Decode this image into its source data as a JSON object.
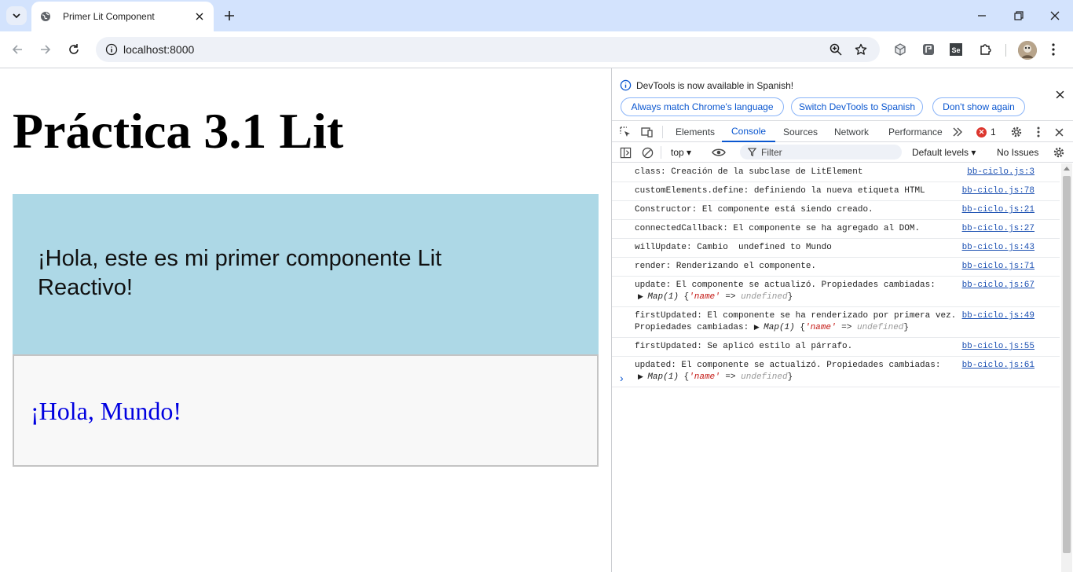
{
  "browser": {
    "tab_title": "Primer Lit Component",
    "url": "localhost:8000"
  },
  "page": {
    "heading": "Práctica 3.1 Lit",
    "component_text": "¡Hola, este es mi primer componente Lit Reactivo!",
    "greeting": "¡Hola, Mundo!"
  },
  "devtools": {
    "infobar": {
      "message": "DevTools is now available in Spanish!",
      "btn_match": "Always match Chrome's language",
      "btn_switch": "Switch DevTools to Spanish",
      "btn_dont_show": "Don't show again"
    },
    "tabs": [
      "Elements",
      "Console",
      "Sources",
      "Network",
      "Performance"
    ],
    "error_count": "1",
    "console": {
      "context": "top",
      "filter_placeholder": "Filter",
      "levels": "Default levels",
      "issues": "No Issues",
      "messages": [
        {
          "text": "class: Creación de la subclase de LitElement",
          "source": "bb-ciclo.js:3"
        },
        {
          "text": "customElements.define: definiendo la nueva etiqueta HTML",
          "source": "bb-ciclo.js:78"
        },
        {
          "text": "Constructor: El componente está siendo creado.",
          "source": "bb-ciclo.js:21"
        },
        {
          "text": "connectedCallback: El componente se ha agregado al DOM.",
          "source": "bb-ciclo.js:27"
        },
        {
          "text": "willUpdate: Cambio  undefined to Mundo",
          "source": "bb-ciclo.js:43"
        },
        {
          "text": "render: Renderizando el componente.",
          "source": "bb-ciclo.js:71"
        },
        {
          "text": "update: El componente se actualizó. Propiedades cambiadas:",
          "source": "bb-ciclo.js:67",
          "map": {
            "prefix": "",
            "label": "Map(1)",
            "key": "'name'",
            "value": "undefined"
          }
        },
        {
          "text": "firstUpdated: El componente se ha renderizado por primera vez.",
          "source": "bb-ciclo.js:49",
          "map": {
            "prefix": "Propiedades cambiadas: ",
            "label": "Map(1)",
            "key": "'name'",
            "value": "undefined"
          }
        },
        {
          "text": "firstUpdated: Se aplicó estilo al párrafo.",
          "source": "bb-ciclo.js:55"
        },
        {
          "text": "updated: El componente se actualizó. Propiedades cambiadas:",
          "source": "bb-ciclo.js:61",
          "map": {
            "prefix": "",
            "label": "Map(1)",
            "key": "'name'",
            "value": "undefined"
          }
        }
      ],
      "prompt": "›"
    }
  },
  "icons": [
    "tab-search-icon",
    "globe-icon",
    "close-icon",
    "plus-icon",
    "minimize-icon",
    "restore-icon",
    "back-icon",
    "forward-icon",
    "reload-icon",
    "info-icon",
    "zoom-icon",
    "star-icon",
    "extension-icon",
    "avatar",
    "menu-icon"
  ]
}
